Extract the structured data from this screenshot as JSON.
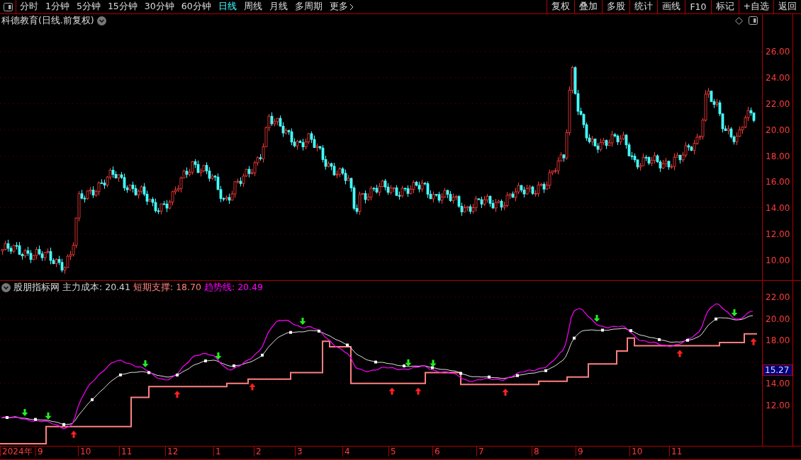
{
  "toolbar": {
    "periods": [
      {
        "label": "分时",
        "selected": false
      },
      {
        "label": "1分钟",
        "selected": false
      },
      {
        "label": "5分钟",
        "selected": false
      },
      {
        "label": "15分钟",
        "selected": false
      },
      {
        "label": "30分钟",
        "selected": false
      },
      {
        "label": "60分钟",
        "selected": false
      },
      {
        "label": "日线",
        "selected": true
      },
      {
        "label": "周线",
        "selected": false
      },
      {
        "label": "月线",
        "selected": false
      },
      {
        "label": "多周期",
        "selected": false
      }
    ],
    "more": "更多",
    "actions": [
      "复权",
      "叠加",
      "多股",
      "统计",
      "画线",
      "F10",
      "标记",
      "+自选",
      "返回"
    ]
  },
  "main_chart": {
    "title": "科德教育(日线.前复权)",
    "y_ticks": [
      "26.00",
      "24.00",
      "22.00",
      "20.00",
      "18.00",
      "16.00",
      "14.00",
      "12.00",
      "10.00"
    ]
  },
  "indicator": {
    "name": "股朋指标网",
    "legend": [
      {
        "label": "主力成本: 20.41",
        "color": "#d0d0d0"
      },
      {
        "label": "短期支撑: 18.70",
        "color": "#ff8080"
      },
      {
        "label": "趋势线: 20.49",
        "color": "#ff00ff"
      }
    ],
    "y_ticks": [
      "22.00",
      "20.00",
      "18.00",
      "14.00",
      "12.00"
    ],
    "cursor_value": "15.27"
  },
  "time_axis": [
    "2024年",
    "9",
    "10",
    "11",
    "12",
    "1",
    "2",
    "3",
    "4",
    "5",
    "6",
    "7",
    "8",
    "9",
    "10",
    "11"
  ]
}
